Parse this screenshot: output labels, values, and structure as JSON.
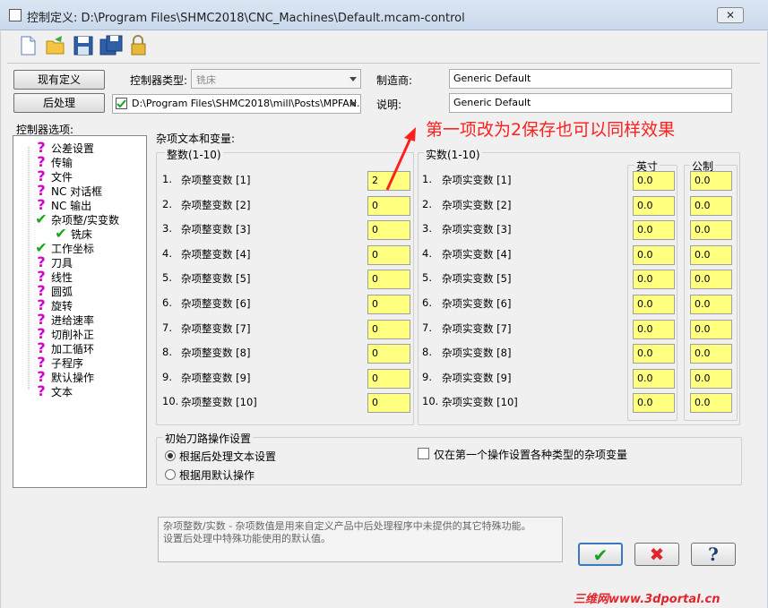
{
  "window": {
    "title": "控制定义: D:\\Program Files\\SHMC2018\\CNC_Machines\\Default.mcam-control",
    "close_label": "✕"
  },
  "toolbar": {
    "icons": [
      "new-file-icon",
      "open-folder-icon",
      "save-icon",
      "save-as-icon",
      "lock-icon"
    ]
  },
  "top": {
    "current_def_button": "现有定义",
    "post_button": "后处理",
    "controller_type_label": "控制器类型:",
    "controller_type_value": "铣床",
    "post_path": "D:\\Program Files\\SHMC2018\\mill\\Posts\\MPFAN.l",
    "manufacturer_label": "制造商:",
    "manufacturer_value": "Generic Default",
    "description_label": "说明:",
    "description_value": "Generic Default"
  },
  "tree": {
    "label": "控制器选项:",
    "items": [
      {
        "text": "公差设置",
        "icon": "question-icon"
      },
      {
        "text": "传输",
        "icon": "question-icon"
      },
      {
        "text": "文件",
        "icon": "question-icon"
      },
      {
        "text": "NC 对话框",
        "icon": "question-icon"
      },
      {
        "text": "NC 输出",
        "icon": "question-icon"
      },
      {
        "text": "杂项整/实变数",
        "icon": "check-icon"
      },
      {
        "text": "铣床",
        "icon": "check-icon"
      },
      {
        "text": "工作坐标",
        "icon": "check-icon"
      },
      {
        "text": "刀具",
        "icon": "question-icon"
      },
      {
        "text": "线性",
        "icon": "question-icon"
      },
      {
        "text": "圆弧",
        "icon": "question-icon"
      },
      {
        "text": "旋转",
        "icon": "question-icon"
      },
      {
        "text": "进给速率",
        "icon": "question-icon"
      },
      {
        "text": "切削补正",
        "icon": "question-icon"
      },
      {
        "text": "加工循环",
        "icon": "question-icon"
      },
      {
        "text": "子程序",
        "icon": "question-icon"
      },
      {
        "text": "默认操作",
        "icon": "question-icon"
      },
      {
        "text": "文本",
        "icon": "question-icon"
      }
    ]
  },
  "main": {
    "section_title": "杂项文本和变量:",
    "integer_group_label": "整数(1-10)",
    "real_group_label": "实数(1-10)",
    "inch_label": "英寸",
    "metric_label": "公制",
    "integers": [
      {
        "num": "1.",
        "label": "杂项整变数 [1]",
        "value": "2"
      },
      {
        "num": "2.",
        "label": "杂项整变数 [2]",
        "value": "0"
      },
      {
        "num": "3.",
        "label": "杂项整变数 [3]",
        "value": "0"
      },
      {
        "num": "4.",
        "label": "杂项整变数 [4]",
        "value": "0"
      },
      {
        "num": "5.",
        "label": "杂项整变数 [5]",
        "value": "0"
      },
      {
        "num": "6.",
        "label": "杂项整变数 [6]",
        "value": "0"
      },
      {
        "num": "7.",
        "label": "杂项整变数 [7]",
        "value": "0"
      },
      {
        "num": "8.",
        "label": "杂项整变数 [8]",
        "value": "0"
      },
      {
        "num": "9.",
        "label": "杂项整变数 [9]",
        "value": "0"
      },
      {
        "num": "10.",
        "label": "杂项整变数 [10]",
        "value": "0"
      }
    ],
    "reals": [
      {
        "num": "1.",
        "label": "杂项实变数 [1]",
        "inch": "0.0",
        "metric": "0.0"
      },
      {
        "num": "2.",
        "label": "杂项实变数 [2]",
        "inch": "0.0",
        "metric": "0.0"
      },
      {
        "num": "3.",
        "label": "杂项实变数 [3]",
        "inch": "0.0",
        "metric": "0.0"
      },
      {
        "num": "4.",
        "label": "杂项实变数 [4]",
        "inch": "0.0",
        "metric": "0.0"
      },
      {
        "num": "5.",
        "label": "杂项实变数 [5]",
        "inch": "0.0",
        "metric": "0.0"
      },
      {
        "num": "6.",
        "label": "杂项实变数 [6]",
        "inch": "0.0",
        "metric": "0.0"
      },
      {
        "num": "7.",
        "label": "杂项实变数 [7]",
        "inch": "0.0",
        "metric": "0.0"
      },
      {
        "num": "8.",
        "label": "杂项实变数 [8]",
        "inch": "0.0",
        "metric": "0.0"
      },
      {
        "num": "9.",
        "label": "杂项实变数 [9]",
        "inch": "0.0",
        "metric": "0.0"
      },
      {
        "num": "10.",
        "label": "杂项实变数 [10]",
        "inch": "0.0",
        "metric": "0.0"
      }
    ],
    "init_group_label": "初始刀路操作设置",
    "radio_post_text": "根据后处理文本设置",
    "radio_default_op": "根据用默认操作",
    "checkbox_first_op": "仅在第一个操作设置各种类型的杂项变量",
    "help_text_line1": "杂项整数/实数 - 杂项数值是用来自定义产品中后处理程序中未提供的其它特殊功能。",
    "help_text_line2": "设置后处理中特殊功能使用的默认值。"
  },
  "annotation": {
    "text": "第一项改为2保存也可以同样效果",
    "color": "#ff2020"
  },
  "buttons": {
    "ok_symbol": "✔",
    "cancel_symbol": "✖",
    "help_symbol": "?"
  },
  "watermark": "三维网www.3dportal.cn",
  "colors": {
    "input_yellow": "#ffff80",
    "question_magenta": "#d100d1",
    "check_green": "#18a41b"
  }
}
